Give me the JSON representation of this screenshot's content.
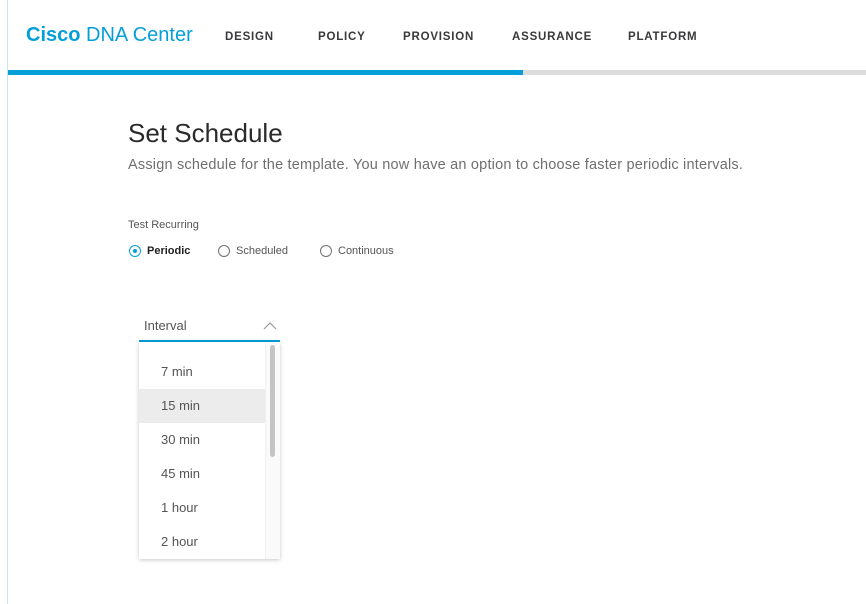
{
  "app": {
    "brand": "Cisco",
    "product": " DNA Center"
  },
  "nav": {
    "items": [
      {
        "label": "DESIGN"
      },
      {
        "label": "POLICY"
      },
      {
        "label": "PROVISION"
      },
      {
        "label": "ASSURANCE"
      },
      {
        "label": "PLATFORM"
      }
    ]
  },
  "progress": {
    "fraction": 0.6,
    "fill_color": "#049fd9"
  },
  "page": {
    "title": "Set Schedule",
    "subtitle": "Assign schedule for the template. You now have an option to choose faster periodic intervals."
  },
  "schedule": {
    "section_label": "Test Recurring",
    "options": [
      {
        "label": "Periodic",
        "selected": true
      },
      {
        "label": "Scheduled",
        "selected": false
      },
      {
        "label": "Continuous",
        "selected": false
      }
    ]
  },
  "interval": {
    "label": "Interval",
    "icon": "chevron-up-icon",
    "options": [
      "7 min",
      "15 min",
      "30 min",
      "45 min",
      "1 hour",
      "2 hour"
    ],
    "highlighted": "15 min"
  },
  "colors": {
    "accent": "#049fd9"
  }
}
